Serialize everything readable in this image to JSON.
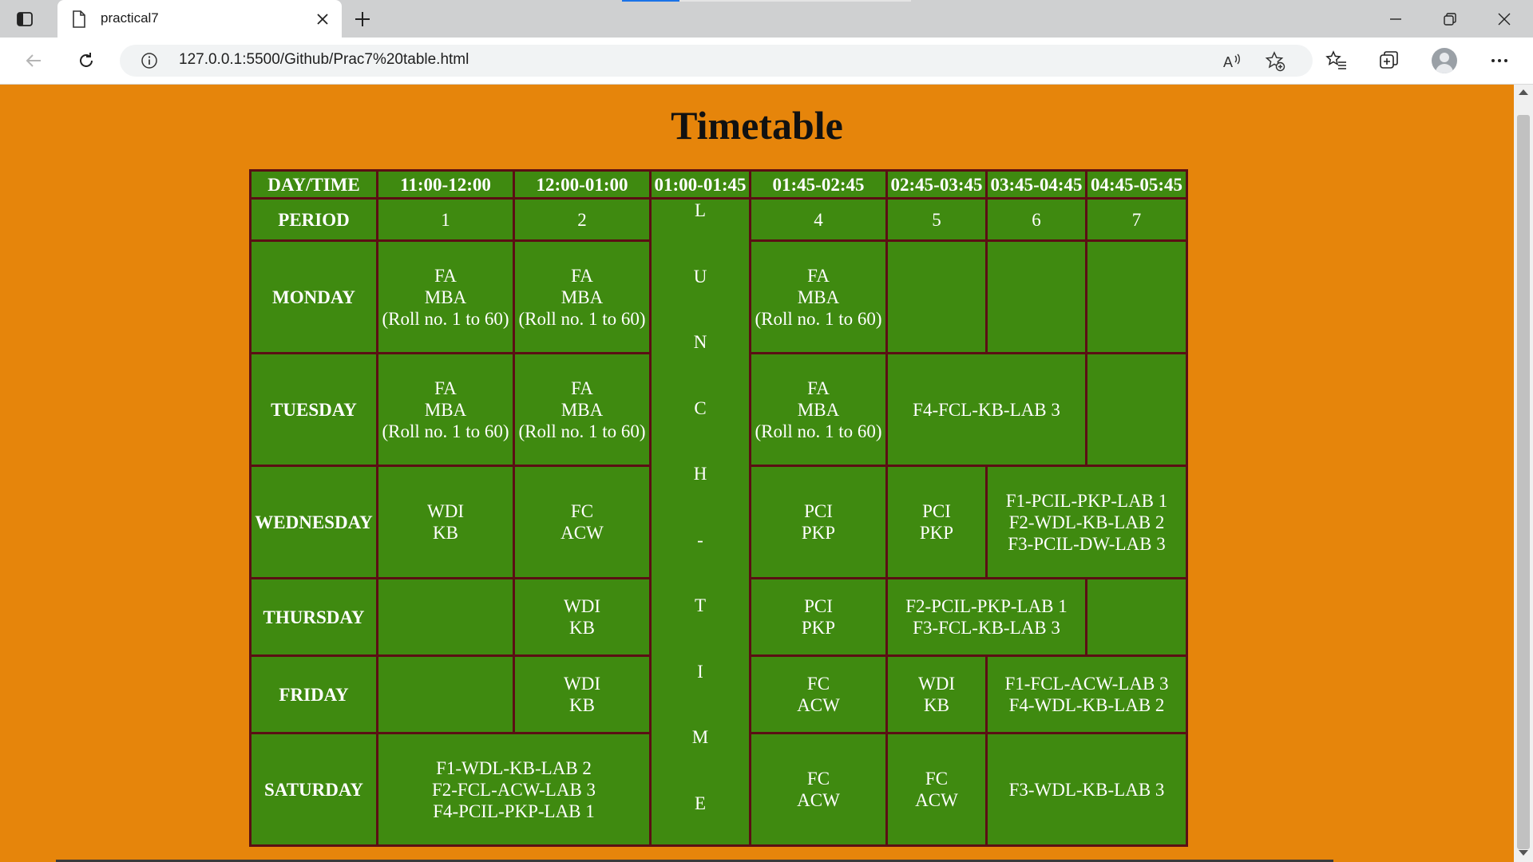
{
  "browser": {
    "tab_title": "practical7",
    "url": "127.0.0.1:5500/Github/Prac7%20table.html"
  },
  "page": {
    "title": "Timetable"
  },
  "timetable": {
    "corner": "DAY/TIME",
    "times": [
      "11:00-12:00",
      "12:00-01:00",
      "01:00-01:45",
      "01:45-02:45",
      "02:45-03:45",
      "03:45-04:45",
      "04:45-05:45"
    ],
    "period_label": "PERIOD",
    "periods": [
      "1",
      "2",
      "4",
      "5",
      "6",
      "7"
    ],
    "lunch_letters": [
      "L",
      "U",
      "N",
      "C",
      "H",
      "-",
      "T",
      "I",
      "M",
      "E"
    ],
    "days": {
      "monday": "MONDAY",
      "tuesday": "TUESDAY",
      "wednesday": "WEDNESDAY",
      "thursday": "THURSDAY",
      "friday": "FRIDAY",
      "saturday": "SATURDAY"
    },
    "fa_subject": "FA",
    "fa_class": "MBA",
    "fa_roll": "(Roll no. 1 to 60)",
    "tuesday_lab": "F4-FCL-KB-LAB 3",
    "wednesday": {
      "p1": [
        "WDI",
        "KB"
      ],
      "p2": [
        "FC",
        "ACW"
      ],
      "p4": [
        "PCI",
        "PKP"
      ],
      "p5": [
        "PCI",
        "PKP"
      ],
      "lab": [
        "F1-PCIL-PKP-LAB 1",
        "F2-WDL-KB-LAB 2",
        "F3-PCIL-DW-LAB 3"
      ]
    },
    "thursday": {
      "p2": [
        "WDI",
        "KB"
      ],
      "p4": [
        "PCI",
        "PKP"
      ],
      "lab": [
        "F2-PCIL-PKP-LAB 1",
        "F3-FCL-KB-LAB 3"
      ]
    },
    "friday": {
      "p2": [
        "WDI",
        "KB"
      ],
      "p4": [
        "FC",
        "ACW"
      ],
      "p5": [
        "WDI",
        "KB"
      ],
      "lab": [
        "F1-FCL-ACW-LAB 3",
        "F4-WDL-KB-LAB 2"
      ]
    },
    "saturday": {
      "lab1": [
        "F1-WDL-KB-LAB 2",
        "F2-FCL-ACW-LAB 3",
        "F4-PCIL-PKP-LAB 1"
      ],
      "p4": [
        "FC",
        "ACW"
      ],
      "p5": [
        "FC",
        "ACW"
      ],
      "lab2": "F3-WDL-KB-LAB 3"
    }
  }
}
